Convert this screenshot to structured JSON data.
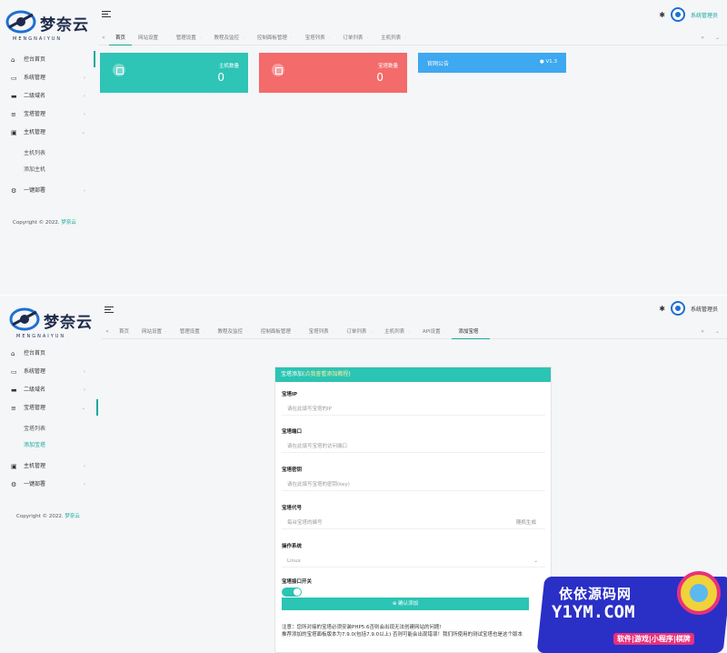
{
  "top": {
    "logo": {
      "text": "梦奈云",
      "sub": "MENGNAIYUN"
    },
    "user": {
      "name": "系统管理员"
    },
    "tabs": [
      "首页",
      "网站设置",
      "管理设置",
      "教程及监控",
      "控制面板管理",
      "宝塔列表",
      "订单列表",
      "主机列表"
    ],
    "sidebar": {
      "items": [
        {
          "label": "控台首页",
          "icon": "home-icon"
        },
        {
          "label": "系统管理",
          "icon": "monitor-icon"
        },
        {
          "label": "二级域名",
          "icon": "folder-icon"
        },
        {
          "label": "宝塔管理",
          "icon": "server-icon"
        },
        {
          "label": "主机管理",
          "icon": "host-icon"
        }
      ],
      "sub": [
        "主机列表",
        "添加主机"
      ],
      "extra": {
        "label": "一键部署",
        "icon": "gear-icon"
      }
    },
    "copyright": {
      "prefix": "Copyright © 2022.",
      "brand": "梦奈云"
    },
    "cards": [
      {
        "title": "主机数量",
        "value": "0",
        "color": "#2ec4b6"
      },
      {
        "title": "宝塔数量",
        "value": "0",
        "color": "#f36b6b"
      }
    ],
    "notice": {
      "title": "官网公告",
      "version": "V1.3"
    }
  },
  "bottom": {
    "logo": {
      "text": "梦奈云",
      "sub": "MENGNAIYUN"
    },
    "user": {
      "name": "系统管理员"
    },
    "tabs": [
      "首页",
      "网站设置",
      "管理设置",
      "教程及监控",
      "控制面板管理",
      "宝塔列表",
      "订单列表",
      "主机列表",
      "API设置",
      "添加宝塔"
    ],
    "sidebar": {
      "items": [
        {
          "label": "控台首页",
          "icon": "home-icon"
        },
        {
          "label": "系统管理",
          "icon": "monitor-icon"
        },
        {
          "label": "二级域名",
          "icon": "folder-icon"
        },
        {
          "label": "宝塔管理",
          "icon": "server-icon"
        }
      ],
      "sub": [
        "宝塔列表",
        "添加宝塔"
      ],
      "extra": [
        {
          "label": "主机管理",
          "icon": "host-icon"
        },
        {
          "label": "一键部署",
          "icon": "gear-icon"
        }
      ]
    },
    "copyright": {
      "prefix": "Copyright © 2022.",
      "brand": "梦奈云"
    },
    "form": {
      "header": "宝塔添加(",
      "header_link": "点我查看添加教程",
      "header_end": ")",
      "fields": [
        {
          "label": "宝塔IP",
          "placeholder": "请在此填写宝塔的IP"
        },
        {
          "label": "宝塔端口",
          "placeholder": "请在此填写宝塔的访问端口"
        },
        {
          "label": "宝塔密钥",
          "placeholder": "请在此填写宝塔的密钥(key)"
        },
        {
          "label": "宝塔代号",
          "placeholder": "每台宝塔的编号",
          "side": "随机生成"
        },
        {
          "label": "操作系统",
          "value": "Linux"
        },
        {
          "label": "宝塔接口开关"
        }
      ],
      "submit": "确认添加",
      "note1": "注意：您所对接的宝塔必须安装PHP5.6否则会出现无法创建网站的问题!",
      "note2": "推荐添加的宝塔面板版本为7.9.0(包括7.9.0以上) 否则可能会出现错误！我们所使用的测试宝塔也是这个版本"
    }
  },
  "watermark": {
    "line1": "依依源码网",
    "line2": "Y1YM.COM",
    "line3": "软件|游戏|小程序|棋牌"
  }
}
